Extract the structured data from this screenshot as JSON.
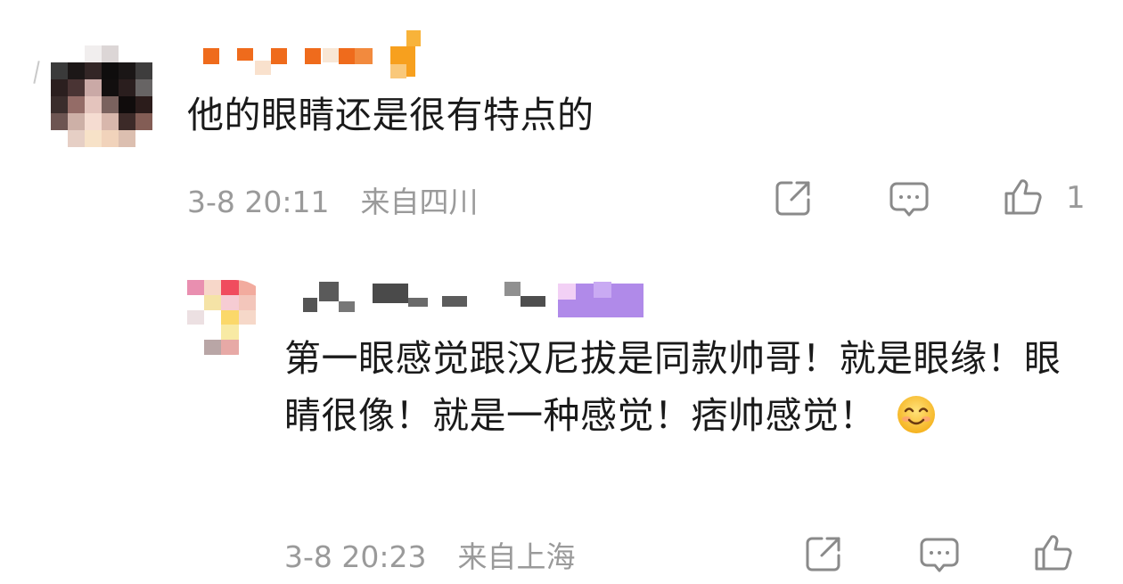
{
  "comment": {
    "username": "",
    "text": "他的眼睛还是很有特点的",
    "timestamp": "3-8 20:11",
    "location": "来自四川",
    "like_count": "1",
    "icons": [
      "share-icon",
      "comment-icon",
      "like-icon"
    ]
  },
  "reply": {
    "username": "",
    "text": "第一眼感觉跟汉尼拔是同款帅哥！就是眼缘！眼睛很像！就是一种感觉！痞帅感觉！",
    "emoji": "smiling-face-emoji",
    "timestamp": "3-8 20:23",
    "location": "来自上海",
    "icons": [
      "share-icon",
      "comment-icon",
      "like-icon"
    ]
  },
  "colors": {
    "text": "#1a1a1a",
    "meta": "#9a9a9a",
    "icon": "#8a8a8a"
  }
}
